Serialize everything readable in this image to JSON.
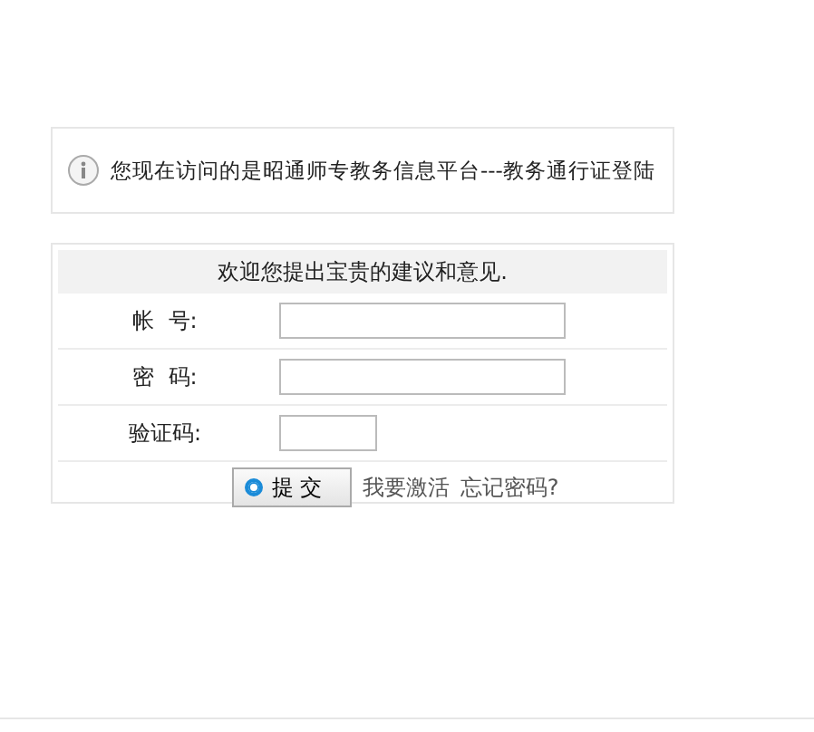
{
  "notice": {
    "text": "您现在访问的是昭通师专教务信息平台---教务通行证登陆"
  },
  "form": {
    "header": "欢迎您提出宝贵的建议和意见.",
    "fields": [
      {
        "label": "帐  号:",
        "kind": "text"
      },
      {
        "label": "密  码:",
        "kind": "password"
      },
      {
        "label": "验证码:",
        "kind": "captcha"
      }
    ],
    "submit": "提 交",
    "links": [
      "我要激活",
      "忘记密码?"
    ]
  }
}
